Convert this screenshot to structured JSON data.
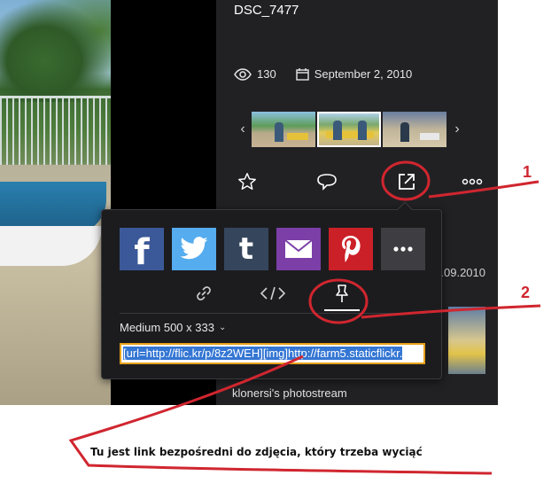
{
  "photo": {
    "title": "DSC_7477"
  },
  "stats": {
    "views": "130",
    "date": "September 2, 2010"
  },
  "filmstrip": {
    "prev": "‹",
    "next": "›"
  },
  "actions": [
    "star-icon",
    "comment-icon",
    "share-icon",
    "more-icon"
  ],
  "share": {
    "buttons": [
      {
        "name": "facebook",
        "glyph": "f",
        "color": "#3b5998"
      },
      {
        "name": "twitter",
        "glyph": "bird",
        "color": "#55acee"
      },
      {
        "name": "tumblr",
        "glyph": "t",
        "color": "#35465c"
      },
      {
        "name": "email",
        "glyph": "envelope",
        "color": "#7b3fa7"
      },
      {
        "name": "pinterest",
        "glyph": "P",
        "color": "#cb2027"
      },
      {
        "name": "more",
        "glyph": "•••",
        "color": "#3e3e42"
      }
    ],
    "tabs": [
      "link-icon",
      "embed-code-icon",
      "pin-icon"
    ],
    "size_label": "Medium 500 x 333",
    "embed_code": "[url=http://flic.kr/p/8z2WEH][img]http://farm5.staticflickr."
  },
  "background": {
    "date_fragment": ".09.2010",
    "photostream": "klonersi's photostream"
  },
  "annotations": {
    "number_1": "1",
    "number_2": "2",
    "note": "Tu jest link bezpośredni do zdjęcia, który trzeba wyciąć",
    "color": "#d0262f"
  }
}
